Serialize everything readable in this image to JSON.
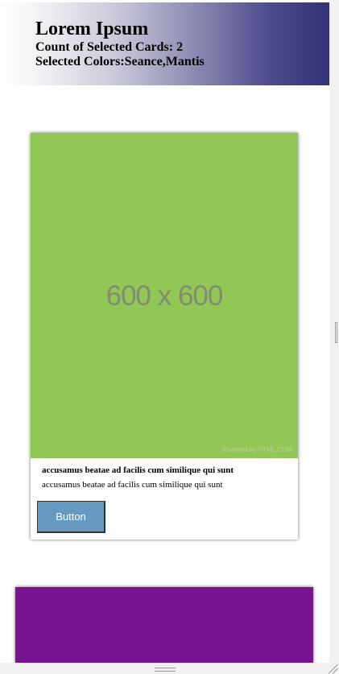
{
  "header": {
    "title": "Lorem Ipsum",
    "count_line": "Count of Selected Cards: 2",
    "colors_line": "Selected Colors:Seance,Mantis"
  },
  "cards": [
    {
      "image_label": "600 x 600",
      "image_watermark": "Powered by HTML.COM",
      "image_color": "#92C655",
      "heading": "accusamus beatae ad facilis cum similique qui sunt",
      "text": "accusamus beatae ad facilis cum similique qui sunt",
      "button_label": "Button"
    },
    {
      "image_color": "#791491"
    }
  ],
  "colors": {
    "header_gradient_end": "#353177",
    "button_bg": "#6699C0"
  }
}
